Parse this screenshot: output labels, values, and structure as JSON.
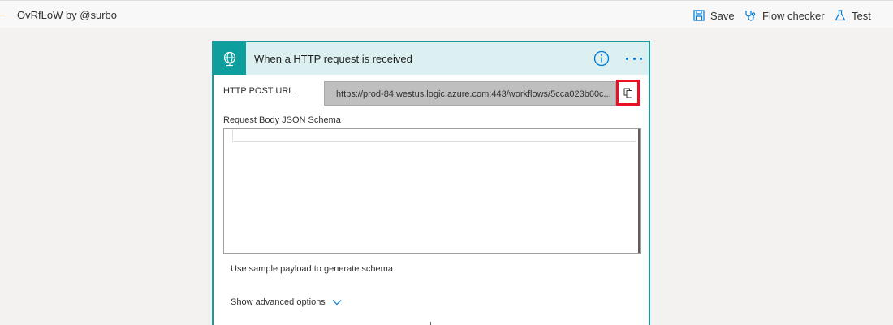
{
  "topbar": {
    "app_title": "OvRfLoW by @surbo",
    "commands": {
      "save": "Save",
      "flow_checker": "Flow checker",
      "test": "Test"
    }
  },
  "card": {
    "title": "When a HTTP request is received",
    "http_post_url_label": "HTTP POST URL",
    "http_post_url_value": "https://prod-84.westus.logic.azure.com:443/workflows/5cca023b60c...",
    "schema_label": "Request Body JSON Schema",
    "schema_value": "",
    "sample_payload_link": "Use sample payload to generate schema",
    "advanced_options_link": "Show advanced options"
  },
  "colors": {
    "accent": "#0078d4",
    "card_border": "#1b9a9a",
    "header_bg": "#dcf0f2",
    "trigger_icon_bg": "#0f9e9e",
    "highlight": "#e81123"
  }
}
